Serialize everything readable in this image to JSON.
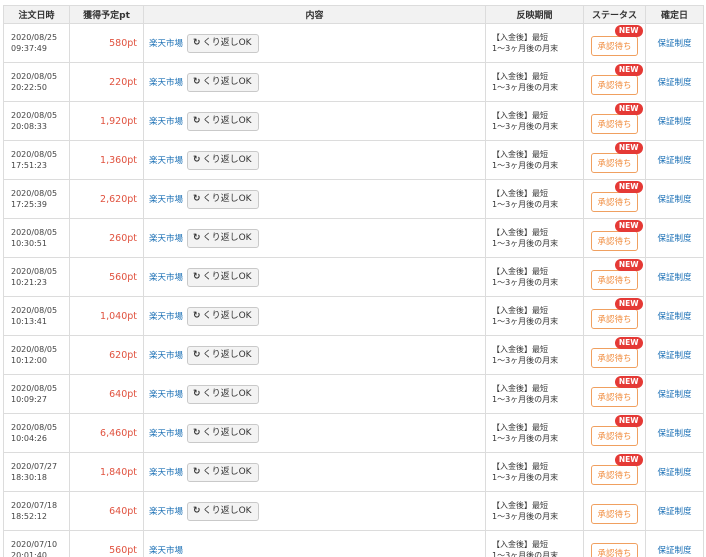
{
  "headers": [
    "注文日時",
    "獲得予定pt",
    "内容",
    "反映期間",
    "ステータス",
    "確定日"
  ],
  "rows": [
    {
      "date": "2020/08/25",
      "time": "09:37:49",
      "pt": "580pt",
      "shop": "楽天市場",
      "kuri": "くり返しOK",
      "period1": "【入金後】最短",
      "period2": "1～3ヶ月後の月末",
      "status": "承認待ち",
      "new": "NEW",
      "confirm": "保証制度"
    },
    {
      "date": "2020/08/05",
      "time": "20:22:50",
      "pt": "220pt",
      "shop": "楽天市場",
      "kuri": "くり返しOK",
      "period1": "【入金後】最短",
      "period2": "1～3ヶ月後の月末",
      "status": "承認待ち",
      "new": "NEW",
      "confirm": "保証制度"
    },
    {
      "date": "2020/08/05",
      "time": "20:08:33",
      "pt": "1,920pt",
      "shop": "楽天市場",
      "kuri": "くり返しOK",
      "period1": "【入金後】最短",
      "period2": "1～3ヶ月後の月末",
      "status": "承認待ち",
      "new": "NEW",
      "confirm": "保証制度"
    },
    {
      "date": "2020/08/05",
      "time": "17:51:23",
      "pt": "1,360pt",
      "shop": "楽天市場",
      "kuri": "くり返しOK",
      "period1": "【入金後】最短",
      "period2": "1～3ヶ月後の月末",
      "status": "承認待ち",
      "new": "NEW",
      "confirm": "保証制度"
    },
    {
      "date": "2020/08/05",
      "time": "17:25:39",
      "pt": "2,620pt",
      "shop": "楽天市場",
      "kuri": "くり返しOK",
      "period1": "【入金後】最短",
      "period2": "1～3ヶ月後の月末",
      "status": "承認待ち",
      "new": "NEW",
      "confirm": "保証制度"
    },
    {
      "date": "2020/08/05",
      "time": "10:30:51",
      "pt": "260pt",
      "shop": "楽天市場",
      "kuri": "くり返しOK",
      "period1": "【入金後】最短",
      "period2": "1～3ヶ月後の月末",
      "status": "承認待ち",
      "new": "NEW",
      "confirm": "保証制度"
    },
    {
      "date": "2020/08/05",
      "time": "10:21:23",
      "pt": "560pt",
      "shop": "楽天市場",
      "kuri": "くり返しOK",
      "period1": "【入金後】最短",
      "period2": "1～3ヶ月後の月末",
      "status": "承認待ち",
      "new": "NEW",
      "confirm": "保証制度"
    },
    {
      "date": "2020/08/05",
      "time": "10:13:41",
      "pt": "1,040pt",
      "shop": "楽天市場",
      "kuri": "くり返しOK",
      "period1": "【入金後】最短",
      "period2": "1～3ヶ月後の月末",
      "status": "承認待ち",
      "new": "NEW",
      "confirm": "保証制度"
    },
    {
      "date": "2020/08/05",
      "time": "10:12:00",
      "pt": "620pt",
      "shop": "楽天市場",
      "kuri": "くり返しOK",
      "period1": "【入金後】最短",
      "period2": "1～3ヶ月後の月末",
      "status": "承認待ち",
      "new": "NEW",
      "confirm": "保証制度"
    },
    {
      "date": "2020/08/05",
      "time": "10:09:27",
      "pt": "640pt",
      "shop": "楽天市場",
      "kuri": "くり返しOK",
      "period1": "【入金後】最短",
      "period2": "1～3ヶ月後の月末",
      "status": "承認待ち",
      "new": "NEW",
      "confirm": "保証制度"
    },
    {
      "date": "2020/08/05",
      "time": "10:04:26",
      "pt": "6,460pt",
      "shop": "楽天市場",
      "kuri": "くり返しOK",
      "period1": "【入金後】最短",
      "period2": "1～3ヶ月後の月末",
      "status": "承認待ち",
      "new": "NEW",
      "confirm": "保証制度"
    },
    {
      "date": "2020/07/27",
      "time": "18:30:18",
      "pt": "1,840pt",
      "shop": "楽天市場",
      "kuri": "くり返しOK",
      "period1": "【入金後】最短",
      "period2": "1～3ヶ月後の月末",
      "status": "承認待ち",
      "new": "NEW",
      "confirm": "保証制度"
    },
    {
      "date": "2020/07/18",
      "time": "18:52:12",
      "pt": "640pt",
      "shop": "楽天市場",
      "kuri": "くり返しOK",
      "period1": "【入金後】最短",
      "period2": "1～3ヶ月後の月末",
      "status": "承認待ち",
      "new": "",
      "confirm": "保証制度"
    },
    {
      "date": "2020/07/10",
      "time": "20:01:40",
      "pt": "560pt",
      "shop": "楽天市場",
      "kuri": "",
      "period1": "【入金後】最短",
      "period2": "1～3ヶ月後の月末",
      "status": "承認待ち",
      "new": "",
      "confirm": "保証制度"
    }
  ],
  "colors": {
    "points": "#e0523f",
    "link": "#1a6fb5",
    "pending_border": "#f0a060",
    "new_badge": "#e53935"
  },
  "icons": {
    "repeat": "reload-icon"
  }
}
